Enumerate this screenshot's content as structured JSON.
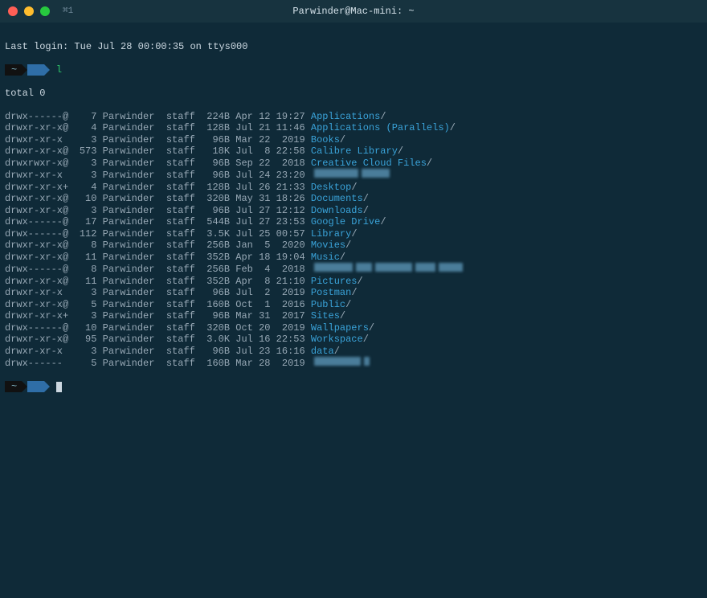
{
  "titlebar": {
    "tab_label": "⌘1",
    "window_title": "Parwinder@Mac-mini: ~"
  },
  "login_line": "Last login: Tue Jul 28 00:00:35 on ttys000",
  "prompt": {
    "seg1": "~",
    "seg2": " "
  },
  "command": "l",
  "total_line": "total 0",
  "listing": [
    {
      "perms": "drwx------@",
      "links": "7",
      "owner": "Parwinder",
      "group": "staff",
      "size": "224B",
      "date": "Apr 12 19:27",
      "name": "Applications",
      "blurred": false
    },
    {
      "perms": "drwxr-xr-x@",
      "links": "4",
      "owner": "Parwinder",
      "group": "staff",
      "size": "128B",
      "date": "Jul 21 11:46",
      "name": "Applications (Parallels)",
      "blurred": false
    },
    {
      "perms": "drwxr-xr-x ",
      "links": "3",
      "owner": "Parwinder",
      "group": "staff",
      "size": "96B",
      "date": "Mar 22  2019",
      "name": "Books",
      "blurred": false
    },
    {
      "perms": "drwxr-xr-x@",
      "links": "573",
      "owner": "Parwinder",
      "group": "staff",
      "size": "18K",
      "date": "Jul  8 22:58",
      "name": "Calibre Library",
      "blurred": false
    },
    {
      "perms": "drwxrwxr-x@",
      "links": "3",
      "owner": "Parwinder",
      "group": "staff",
      "size": "96B",
      "date": "Sep 22  2018",
      "name": "Creative Cloud Files",
      "blurred": false
    },
    {
      "perms": "drwxr-xr-x ",
      "links": "3",
      "owner": "Parwinder",
      "group": "staff",
      "size": "96B",
      "date": "Jul 24 23:20",
      "name": "",
      "blurred": true,
      "blur_widths": [
        55,
        35
      ]
    },
    {
      "perms": "drwxr-xr-x+",
      "links": "4",
      "owner": "Parwinder",
      "group": "staff",
      "size": "128B",
      "date": "Jul 26 21:33",
      "name": "Desktop",
      "blurred": false
    },
    {
      "perms": "drwxr-xr-x@",
      "links": "10",
      "owner": "Parwinder",
      "group": "staff",
      "size": "320B",
      "date": "May 31 18:26",
      "name": "Documents",
      "blurred": false
    },
    {
      "perms": "drwxr-xr-x@",
      "links": "3",
      "owner": "Parwinder",
      "group": "staff",
      "size": "96B",
      "date": "Jul 27 12:12",
      "name": "Downloads",
      "blurred": false
    },
    {
      "perms": "drwx------@",
      "links": "17",
      "owner": "Parwinder",
      "group": "staff",
      "size": "544B",
      "date": "Jul 27 23:53",
      "name": "Google Drive",
      "blurred": false
    },
    {
      "perms": "drwx------@",
      "links": "112",
      "owner": "Parwinder",
      "group": "staff",
      "size": "3.5K",
      "date": "Jul 25 00:57",
      "name": "Library",
      "blurred": false
    },
    {
      "perms": "drwxr-xr-x@",
      "links": "8",
      "owner": "Parwinder",
      "group": "staff",
      "size": "256B",
      "date": "Jan  5  2020",
      "name": "Movies",
      "blurred": false
    },
    {
      "perms": "drwxr-xr-x@",
      "links": "11",
      "owner": "Parwinder",
      "group": "staff",
      "size": "352B",
      "date": "Apr 18 19:04",
      "name": "Music",
      "blurred": false
    },
    {
      "perms": "drwx------@",
      "links": "8",
      "owner": "Parwinder",
      "group": "staff",
      "size": "256B",
      "date": "Feb  4  2018",
      "name": "",
      "blurred": true,
      "blur_widths": [
        48,
        20,
        46,
        25,
        30
      ]
    },
    {
      "perms": "drwxr-xr-x@",
      "links": "11",
      "owner": "Parwinder",
      "group": "staff",
      "size": "352B",
      "date": "Apr  8 21:10",
      "name": "Pictures",
      "blurred": false
    },
    {
      "perms": "drwxr-xr-x ",
      "links": "3",
      "owner": "Parwinder",
      "group": "staff",
      "size": "96B",
      "date": "Jul  2  2019",
      "name": "Postman",
      "blurred": false
    },
    {
      "perms": "drwxr-xr-x@",
      "links": "5",
      "owner": "Parwinder",
      "group": "staff",
      "size": "160B",
      "date": "Oct  1  2016",
      "name": "Public",
      "blurred": false
    },
    {
      "perms": "drwxr-xr-x+",
      "links": "3",
      "owner": "Parwinder",
      "group": "staff",
      "size": "96B",
      "date": "Mar 31  2017",
      "name": "Sites",
      "blurred": false
    },
    {
      "perms": "drwx------@",
      "links": "10",
      "owner": "Parwinder",
      "group": "staff",
      "size": "320B",
      "date": "Oct 20  2019",
      "name": "Wallpapers",
      "blurred": false
    },
    {
      "perms": "drwxr-xr-x@",
      "links": "95",
      "owner": "Parwinder",
      "group": "staff",
      "size": "3.0K",
      "date": "Jul 16 22:53",
      "name": "Workspace",
      "blurred": false
    },
    {
      "perms": "drwxr-xr-x ",
      "links": "3",
      "owner": "Parwinder",
      "group": "staff",
      "size": "96B",
      "date": "Jul 23 16:16",
      "name": "data",
      "blurred": false
    },
    {
      "perms": "drwx------ ",
      "links": "5",
      "owner": "Parwinder",
      "group": "staff",
      "size": "160B",
      "date": "Mar 28  2019",
      "name": "",
      "blurred": true,
      "blur_widths": [
        58,
        7
      ]
    }
  ]
}
